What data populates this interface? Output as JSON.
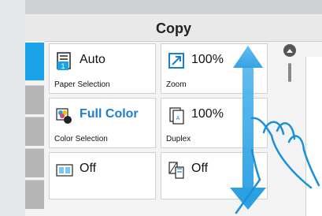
{
  "header": {
    "title": "Copy"
  },
  "tiles": [
    {
      "value": "Auto",
      "label": "Paper Selection",
      "icon": "paper-selection-icon"
    },
    {
      "value": "100%",
      "label": "Zoom",
      "icon": "zoom-icon"
    },
    {
      "value": "Full Color",
      "label": "Color Selection",
      "icon": "color-selection-icon",
      "accent": "#1b7fd1"
    },
    {
      "value": "100%",
      "label": "Duplex",
      "icon": "duplex-icon"
    },
    {
      "value": "Off",
      "label": "",
      "icon": "combine-icon"
    },
    {
      "value": "Off",
      "label": "",
      "icon": "original-orientation-icon"
    }
  ],
  "colors": {
    "accent_blue": "#1aa3e8",
    "arrow_blue": "#2d9fe3"
  },
  "gesture": {
    "type": "vertical-swipe",
    "icon": "hand-swipe-icon"
  }
}
